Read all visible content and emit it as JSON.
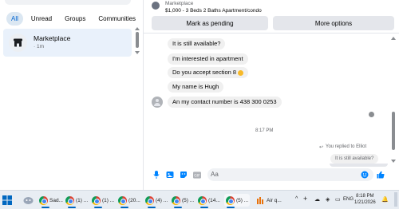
{
  "sidebar": {
    "filters": [
      "All",
      "Unread",
      "Groups",
      "Communities"
    ],
    "conversation": {
      "title": "Marketplace",
      "time": "· 1m"
    }
  },
  "chat_header": {
    "subtitle": "Marketplace",
    "title": "$1,000 - 3 Beds 2 Baths Apartment/condo",
    "mark_pending": "Mark as pending",
    "more_options": "More options"
  },
  "messages": [
    "It is still available?",
    "I'm interested in apartment",
    "Do you accept section 8",
    "My name is Hugh",
    "An my contact number is 438 300 0253"
  ],
  "timestamp": "8:17 PM",
  "replied_label": "You replied to Elliot",
  "quoted_text": "It is still available?",
  "composer": {
    "placeholder": "Aa"
  },
  "taskbar": {
    "items": [
      "Sad...",
      "(1) ...",
      "(1) ...",
      "(20...",
      "(4) ...",
      "(5) ...",
      "(14...",
      "(5) ...",
      "Air q..."
    ],
    "lang": "ENG",
    "time": "8:18 PM",
    "date": "1/21/2026"
  },
  "colors": {
    "accent": "#0084ff",
    "active_chip": "#dbe7f2",
    "bubble": "#f0f0f0"
  }
}
